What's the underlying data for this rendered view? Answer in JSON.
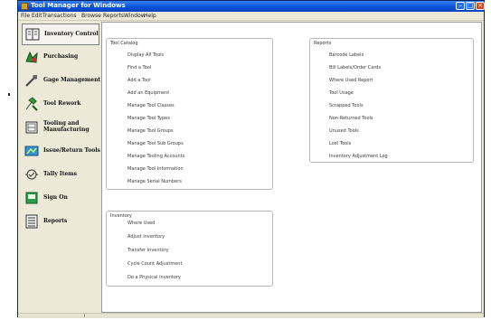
{
  "window": {
    "title": "Tool Manager for Windows",
    "min_glyph": "–",
    "max_glyph": "□",
    "close_glyph": "×"
  },
  "menu": [
    "File",
    "Edit",
    "Transactions",
    "Browse",
    "Reports",
    "Window",
    "Help"
  ],
  "sidebar": {
    "items": [
      {
        "label": "Inventory Control",
        "icon": "inventory-icon",
        "active": true
      },
      {
        "label": "Purchasing",
        "icon": "purchasing-icon"
      },
      {
        "label": "Gage Management",
        "icon": "gage-icon"
      },
      {
        "label": "Tool Rework",
        "icon": "tool-rework-icon"
      },
      {
        "label": "Tooling and",
        "label2": "Manufacturing",
        "icon": "tooling-icon"
      },
      {
        "label": "Issue/Return Tools",
        "icon": "issue-return-icon"
      },
      {
        "label": "Tally Items",
        "icon": "tally-icon"
      },
      {
        "label": "Sign On",
        "icon": "sign-on-icon"
      },
      {
        "label": "Reports",
        "icon": "reports-icon"
      }
    ]
  },
  "tool_catalog": {
    "title": "Tool Catalog",
    "links": [
      "Display All Tools",
      "Find a Tool",
      "Add a Tool",
      "Add an Equipment",
      "Manage Tool Classes",
      "Manage Tool Types",
      "Manage Tool Groups",
      "Manage Tool Sub Groups",
      "Manage Tooling Accounts",
      "Manage Tool Information",
      "Manage Serial Numbers"
    ]
  },
  "inventory": {
    "title": "Inventory",
    "links": [
      "Where Used",
      "Adjust Inventory",
      "Transfer Inventory",
      "Cycle Count Adjustment",
      "Do a Physical Inventory"
    ]
  },
  "reports": {
    "title": "Reports",
    "links": [
      "Barcode Labels",
      "Bill Labels/Order Cards",
      "Where Used Report",
      "Tool Usage",
      "Scrapped Tools",
      "Non-Returned Tools",
      "Unused Tools",
      "Lost Tools",
      "Inventory Adjustment Log"
    ]
  },
  "colors": {
    "titlebar": "#0a53d9",
    "window_bg": "#ece9d8",
    "accent_arrow": "#3b5fb0"
  }
}
